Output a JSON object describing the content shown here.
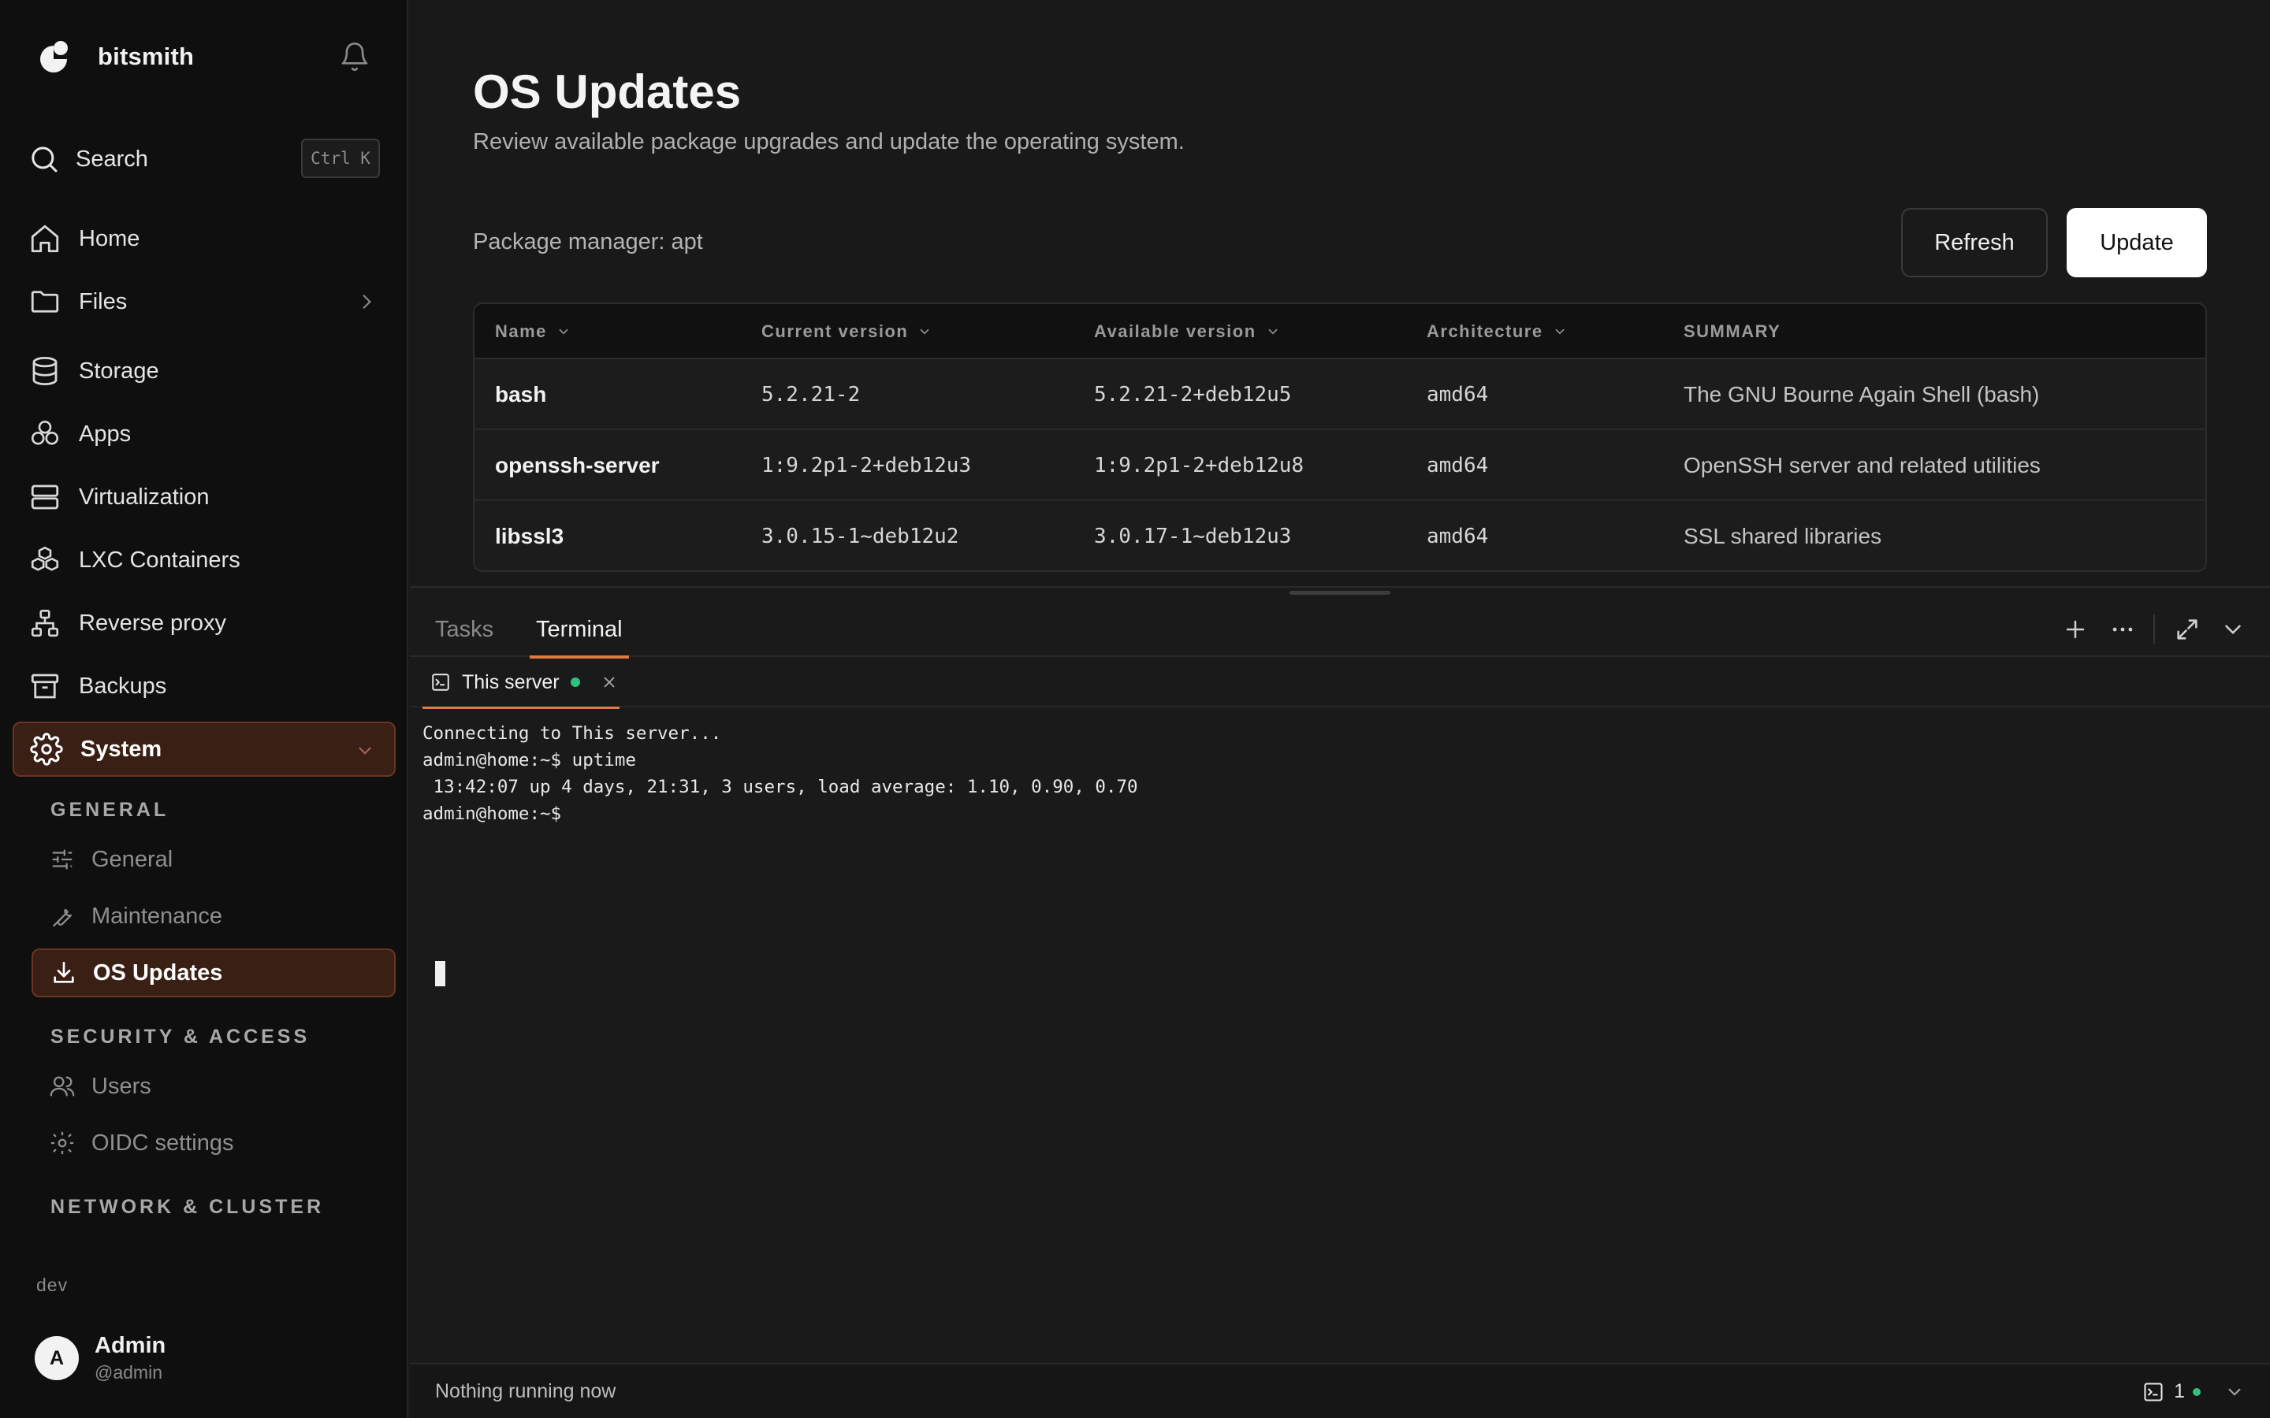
{
  "app": {
    "name": "bitsmith"
  },
  "search": {
    "label": "Search",
    "shortcut": "Ctrl K"
  },
  "sidebar": {
    "items": [
      {
        "label": "Home",
        "icon": "home-icon"
      },
      {
        "label": "Files",
        "icon": "folder-icon"
      },
      {
        "label": "Storage",
        "icon": "database-icon"
      },
      {
        "label": "Apps",
        "icon": "apps-icon"
      },
      {
        "label": "Virtualization",
        "icon": "server-icon"
      },
      {
        "label": "LXC Containers",
        "icon": "boxes-icon"
      },
      {
        "label": "Reverse proxy",
        "icon": "network-icon"
      },
      {
        "label": "Backups",
        "icon": "archive-icon"
      },
      {
        "label": "System",
        "icon": "gear-icon"
      }
    ],
    "sections": [
      {
        "label": "GENERAL"
      },
      {
        "label": "SECURITY & ACCESS"
      },
      {
        "label": "NETWORK & CLUSTER"
      }
    ],
    "sub_items": [
      {
        "label": "General",
        "icon": "sliders-icon"
      },
      {
        "label": "Maintenance",
        "icon": "wrench-icon"
      },
      {
        "label": "OS Updates",
        "icon": "download-icon"
      },
      {
        "label": "Users",
        "icon": "users-icon"
      },
      {
        "label": "OIDC settings",
        "icon": "gear-icon"
      }
    ],
    "env": "dev",
    "user": {
      "initial": "A",
      "name": "Admin",
      "handle": "@admin"
    }
  },
  "page": {
    "title": "OS Updates",
    "subtitle": "Review available package upgrades and update the operating system.",
    "package_manager": "Package manager: apt",
    "refresh_label": "Refresh",
    "update_label": "Update"
  },
  "table": {
    "columns": [
      "Name",
      "Current version",
      "Available version",
      "Architecture",
      "SUMMARY"
    ],
    "rows": [
      {
        "name": "bash",
        "current": "5.2.21-2",
        "available": "5.2.21-2+deb12u5",
        "arch": "amd64",
        "summary": "The GNU Bourne Again Shell (bash)"
      },
      {
        "name": "openssh-server",
        "current": "1:9.2p1-2+deb12u3",
        "available": "1:9.2p1-2+deb12u8",
        "arch": "amd64",
        "summary": "OpenSSH server and related utilities"
      },
      {
        "name": "libssl3",
        "current": "3.0.15-1~deb12u2",
        "available": "3.0.17-1~deb12u3",
        "arch": "amd64",
        "summary": "SSL shared libraries"
      }
    ]
  },
  "panel": {
    "tabs": [
      "Tasks",
      "Terminal"
    ],
    "terminal_tab": "This server",
    "terminal_lines": [
      "Connecting to This server...",
      "admin@home:~$ uptime",
      " 13:42:07 up 4 days, 21:31, 3 users, load average: 1.10, 0.90, 0.70",
      "admin@home:~$"
    ],
    "status_text": "Nothing running now",
    "terminal_count": "1"
  },
  "colors": {
    "accent": "#e07a3f",
    "active_bg": "#3a1f14",
    "online": "#2ec27e"
  }
}
